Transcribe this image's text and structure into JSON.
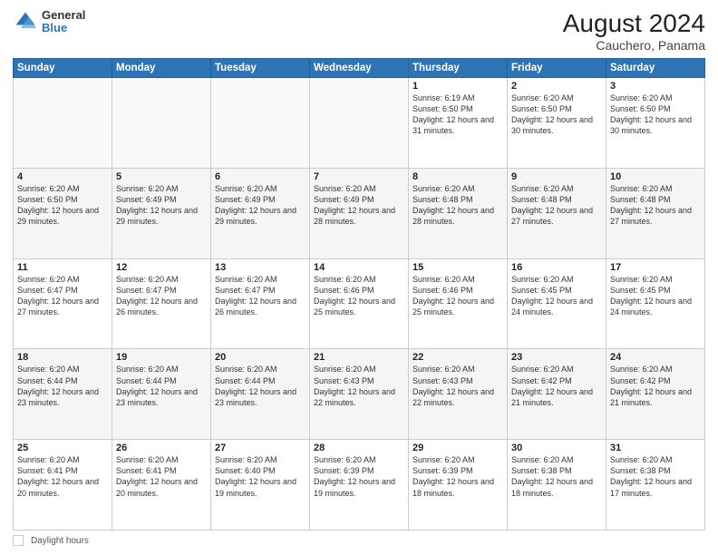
{
  "header": {
    "logo_general": "General",
    "logo_blue": "Blue",
    "month_year": "August 2024",
    "location": "Cauchero, Panama"
  },
  "footer": {
    "label": "Daylight hours"
  },
  "days_of_week": [
    "Sunday",
    "Monday",
    "Tuesday",
    "Wednesday",
    "Thursday",
    "Friday",
    "Saturday"
  ],
  "weeks": [
    [
      {
        "day": "",
        "info": ""
      },
      {
        "day": "",
        "info": ""
      },
      {
        "day": "",
        "info": ""
      },
      {
        "day": "",
        "info": ""
      },
      {
        "day": "1",
        "info": "Sunrise: 6:19 AM\nSunset: 6:50 PM\nDaylight: 12 hours\nand 31 minutes."
      },
      {
        "day": "2",
        "info": "Sunrise: 6:20 AM\nSunset: 6:50 PM\nDaylight: 12 hours\nand 30 minutes."
      },
      {
        "day": "3",
        "info": "Sunrise: 6:20 AM\nSunset: 6:50 PM\nDaylight: 12 hours\nand 30 minutes."
      }
    ],
    [
      {
        "day": "4",
        "info": "Sunrise: 6:20 AM\nSunset: 6:50 PM\nDaylight: 12 hours\nand 29 minutes."
      },
      {
        "day": "5",
        "info": "Sunrise: 6:20 AM\nSunset: 6:49 PM\nDaylight: 12 hours\nand 29 minutes."
      },
      {
        "day": "6",
        "info": "Sunrise: 6:20 AM\nSunset: 6:49 PM\nDaylight: 12 hours\nand 29 minutes."
      },
      {
        "day": "7",
        "info": "Sunrise: 6:20 AM\nSunset: 6:49 PM\nDaylight: 12 hours\nand 28 minutes."
      },
      {
        "day": "8",
        "info": "Sunrise: 6:20 AM\nSunset: 6:48 PM\nDaylight: 12 hours\nand 28 minutes."
      },
      {
        "day": "9",
        "info": "Sunrise: 6:20 AM\nSunset: 6:48 PM\nDaylight: 12 hours\nand 27 minutes."
      },
      {
        "day": "10",
        "info": "Sunrise: 6:20 AM\nSunset: 6:48 PM\nDaylight: 12 hours\nand 27 minutes."
      }
    ],
    [
      {
        "day": "11",
        "info": "Sunrise: 6:20 AM\nSunset: 6:47 PM\nDaylight: 12 hours\nand 27 minutes."
      },
      {
        "day": "12",
        "info": "Sunrise: 6:20 AM\nSunset: 6:47 PM\nDaylight: 12 hours\nand 26 minutes."
      },
      {
        "day": "13",
        "info": "Sunrise: 6:20 AM\nSunset: 6:47 PM\nDaylight: 12 hours\nand 26 minutes."
      },
      {
        "day": "14",
        "info": "Sunrise: 6:20 AM\nSunset: 6:46 PM\nDaylight: 12 hours\nand 25 minutes."
      },
      {
        "day": "15",
        "info": "Sunrise: 6:20 AM\nSunset: 6:46 PM\nDaylight: 12 hours\nand 25 minutes."
      },
      {
        "day": "16",
        "info": "Sunrise: 6:20 AM\nSunset: 6:45 PM\nDaylight: 12 hours\nand 24 minutes."
      },
      {
        "day": "17",
        "info": "Sunrise: 6:20 AM\nSunset: 6:45 PM\nDaylight: 12 hours\nand 24 minutes."
      }
    ],
    [
      {
        "day": "18",
        "info": "Sunrise: 6:20 AM\nSunset: 6:44 PM\nDaylight: 12 hours\nand 23 minutes."
      },
      {
        "day": "19",
        "info": "Sunrise: 6:20 AM\nSunset: 6:44 PM\nDaylight: 12 hours\nand 23 minutes."
      },
      {
        "day": "20",
        "info": "Sunrise: 6:20 AM\nSunset: 6:44 PM\nDaylight: 12 hours\nand 23 minutes."
      },
      {
        "day": "21",
        "info": "Sunrise: 6:20 AM\nSunset: 6:43 PM\nDaylight: 12 hours\nand 22 minutes."
      },
      {
        "day": "22",
        "info": "Sunrise: 6:20 AM\nSunset: 6:43 PM\nDaylight: 12 hours\nand 22 minutes."
      },
      {
        "day": "23",
        "info": "Sunrise: 6:20 AM\nSunset: 6:42 PM\nDaylight: 12 hours\nand 21 minutes."
      },
      {
        "day": "24",
        "info": "Sunrise: 6:20 AM\nSunset: 6:42 PM\nDaylight: 12 hours\nand 21 minutes."
      }
    ],
    [
      {
        "day": "25",
        "info": "Sunrise: 6:20 AM\nSunset: 6:41 PM\nDaylight: 12 hours\nand 20 minutes."
      },
      {
        "day": "26",
        "info": "Sunrise: 6:20 AM\nSunset: 6:41 PM\nDaylight: 12 hours\nand 20 minutes."
      },
      {
        "day": "27",
        "info": "Sunrise: 6:20 AM\nSunset: 6:40 PM\nDaylight: 12 hours\nand 19 minutes."
      },
      {
        "day": "28",
        "info": "Sunrise: 6:20 AM\nSunset: 6:39 PM\nDaylight: 12 hours\nand 19 minutes."
      },
      {
        "day": "29",
        "info": "Sunrise: 6:20 AM\nSunset: 6:39 PM\nDaylight: 12 hours\nand 18 minutes."
      },
      {
        "day": "30",
        "info": "Sunrise: 6:20 AM\nSunset: 6:38 PM\nDaylight: 12 hours\nand 18 minutes."
      },
      {
        "day": "31",
        "info": "Sunrise: 6:20 AM\nSunset: 6:38 PM\nDaylight: 12 hours\nand 17 minutes."
      }
    ]
  ]
}
